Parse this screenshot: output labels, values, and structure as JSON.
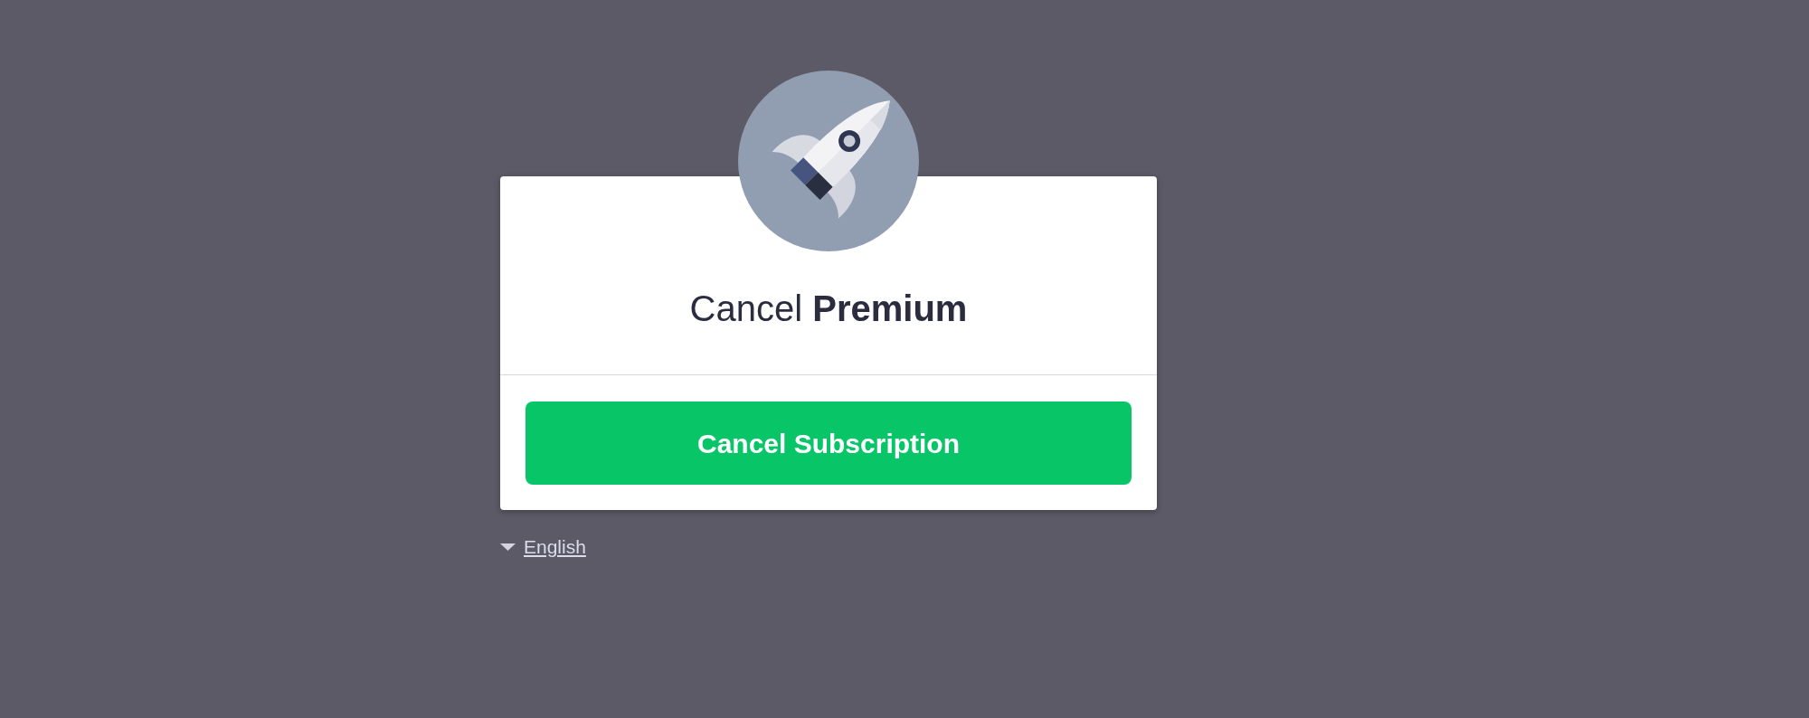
{
  "dialog": {
    "title": "Cancel **Premium**",
    "button": "Cancel Subscription"
  },
  "language_selector": {
    "label": "English"
  }
}
